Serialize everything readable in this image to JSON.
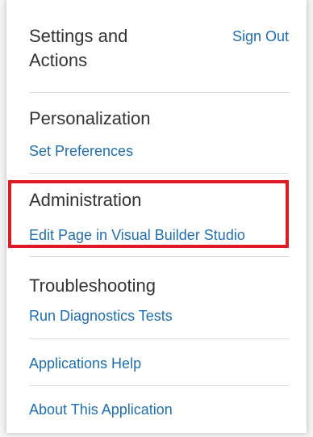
{
  "header": {
    "title": "Settings and Actions",
    "sign_out": "Sign Out"
  },
  "sections": {
    "personalization": {
      "title": "Personalization",
      "link": "Set Preferences"
    },
    "administration": {
      "title": "Administration",
      "link": "Edit Page in Visual Builder Studio"
    },
    "troubleshooting": {
      "title": "Troubleshooting",
      "link": "Run Diagnostics Tests"
    }
  },
  "links": {
    "applications_help": "Applications Help",
    "about": "About This Application"
  },
  "colors": {
    "link": "#1f6fb0",
    "text": "#333333",
    "highlight": "#e01a24",
    "divider": "#dadada"
  }
}
